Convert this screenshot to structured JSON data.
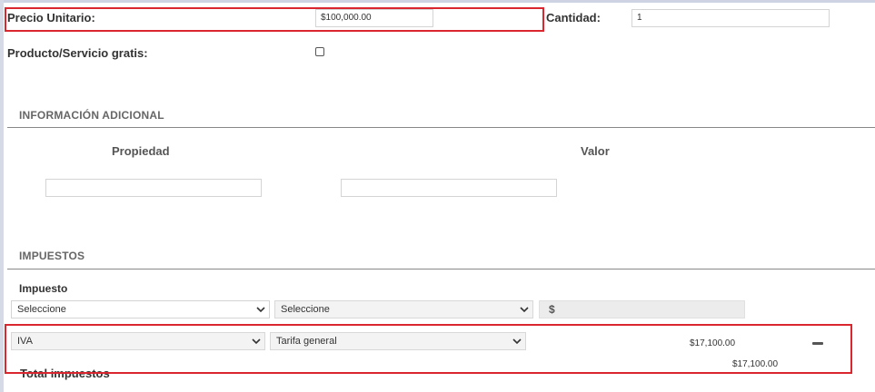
{
  "precio_unitario": {
    "label": "Precio Unitario:",
    "value": "$100,000.00"
  },
  "cantidad": {
    "label": "Cantidad:",
    "value": "1"
  },
  "gratis": {
    "label": "Producto/Servicio gratis:",
    "checked": false
  },
  "info_adicional": {
    "title": "INFORMACIÓN ADICIONAL",
    "col_propiedad": "Propiedad",
    "col_valor": "Valor",
    "propiedad_value": "",
    "valor_value": ""
  },
  "impuestos": {
    "title": "IMPUESTOS",
    "impuesto_label": "Impuesto",
    "new_row": {
      "tax_select": "Seleccione",
      "rate_select": "Seleccione",
      "currency_symbol": "$",
      "amount": ""
    },
    "rows": [
      {
        "tax": "IVA",
        "rate": "Tarifa general",
        "amount": "$17,100.00"
      }
    ],
    "total_label": "Total impuestos",
    "total_value": "$17,100.00"
  },
  "colors": {
    "highlight": "#d9262f",
    "rule": "#888888",
    "select_bg": "#f3f3f3"
  },
  "icons": {
    "dropdown": "chevron-down-icon",
    "remove": "minus-icon"
  }
}
